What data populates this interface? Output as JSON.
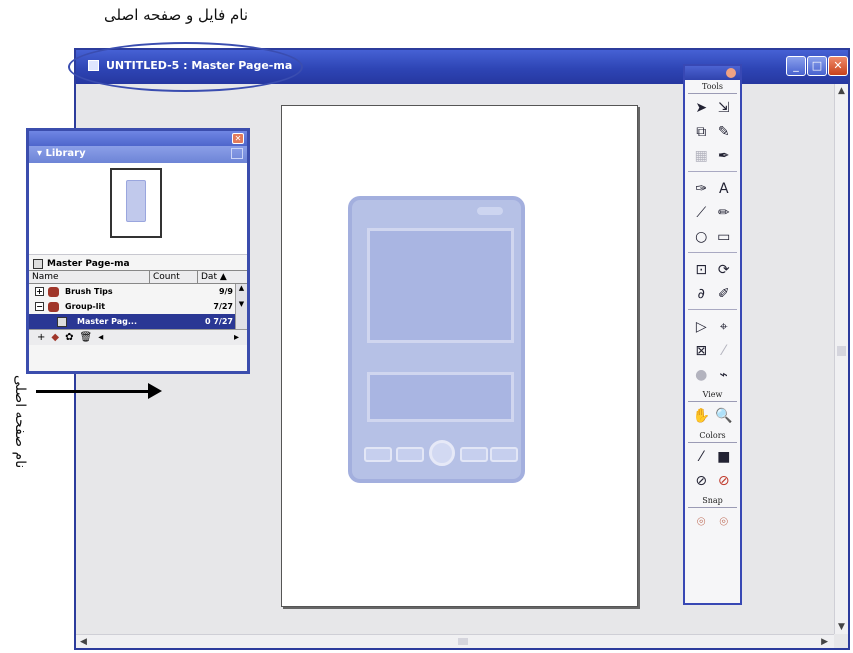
{
  "captions": {
    "top": "نام فایل و صفحه اصلی",
    "side": "نام صفحه اصلی"
  },
  "window": {
    "title": "UNTITLED-5 : Master Page-ma",
    "buttons": {
      "minimize": "_",
      "maximize": "□",
      "close": "✕"
    }
  },
  "tools_panel": {
    "sections": {
      "tools": "Tools",
      "view": "View",
      "colors": "Colors",
      "snap": "Snap"
    },
    "tool_glyphs": {
      "pointer": "➤",
      "subselect": "⇲",
      "scale": "⧉",
      "lasso": "✎",
      "crop": "▦",
      "eyedropper": "✒",
      "pen": "✑",
      "text": "A",
      "line": "⟋",
      "pencil": "✏",
      "ellipse": "○",
      "rectangle": "▭",
      "free-transform": "⊡",
      "distort": "⟳",
      "freeform": "∂",
      "brush": "✐",
      "reshape": "▷",
      "tweak": "⌖",
      "path-scrubber": "⊠",
      "smudge": "⁄",
      "fill": "●",
      "knife": "⌁",
      "hand": "✋",
      "zoom": "🔍",
      "stroke-color": "⁄",
      "fill-color": "■",
      "swap": "⊘",
      "none": "⊘",
      "snap-a": "⌾",
      "snap-b": "⌾"
    }
  },
  "library": {
    "header": "▾ Library",
    "item_name": "Master Page-ma",
    "columns": {
      "name": "Name",
      "count": "Count",
      "date": "Dat ▲"
    },
    "rows": [
      {
        "expander": "+",
        "label": "Brush Tips",
        "count": "9/9"
      },
      {
        "expander": "−",
        "label": "Group-lit",
        "count": "7/27"
      },
      {
        "expander": "",
        "label": "Master Pag...",
        "count": "0 7/27"
      }
    ],
    "bottom_icons": [
      "+",
      "◆",
      "✿",
      "🗑",
      "◂",
      "▸"
    ]
  }
}
